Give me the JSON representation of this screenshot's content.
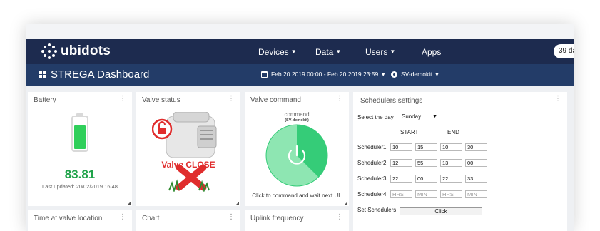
{
  "nav": {
    "brand": "ubidots",
    "items": [
      {
        "label": "Devices"
      },
      {
        "label": "Data"
      },
      {
        "label": "Users"
      },
      {
        "label": "Apps"
      }
    ],
    "trial": "39 da"
  },
  "dashboard": {
    "title": "STREGA Dashboard",
    "date_range": "Feb 20 2019 00:00 - Feb 20 2019 23:59",
    "device": "SV-demokit"
  },
  "widgets": {
    "battery": {
      "title": "Battery",
      "value": "83.81",
      "updated": "Last updated: 20/02/2019 16:48",
      "level": 0.84
    },
    "valve_status": {
      "title": "Valve status",
      "state_label": "Valve CLOSE"
    },
    "valve_command": {
      "title": "Valve command",
      "variable": "command",
      "device": "(SV-demokit)",
      "hint": "Click to command and wait next UL"
    },
    "schedulers": {
      "title": "Schedulers settings",
      "select_day_label": "Select the day",
      "selected_day": "Sunday",
      "start_label": "START",
      "end_label": "END",
      "rows": [
        {
          "label": "Scheduler1",
          "values": [
            "10",
            "15",
            "10",
            "30"
          ]
        },
        {
          "label": "Scheduler2",
          "values": [
            "12",
            "55",
            "13",
            "00"
          ]
        },
        {
          "label": "Scheduler3",
          "values": [
            "22",
            "00",
            "22",
            "33"
          ]
        },
        {
          "label": "Scheduler4",
          "values": [],
          "placeholders": [
            "HRS",
            "MIN",
            "HRS",
            "MIN"
          ]
        }
      ],
      "set_label": "Set Schedulers",
      "button_label": "Click"
    },
    "time_location": {
      "title": "Time at valve location"
    },
    "chart": {
      "title": "Chart"
    },
    "uplink": {
      "title": "Uplink frequency"
    }
  },
  "colors": {
    "nav": "#1d2b4f",
    "subnav": "#233c68",
    "battery_green": "#2fcf5a",
    "knob": "#3ecf7a",
    "value_green": "#1fa34a"
  }
}
